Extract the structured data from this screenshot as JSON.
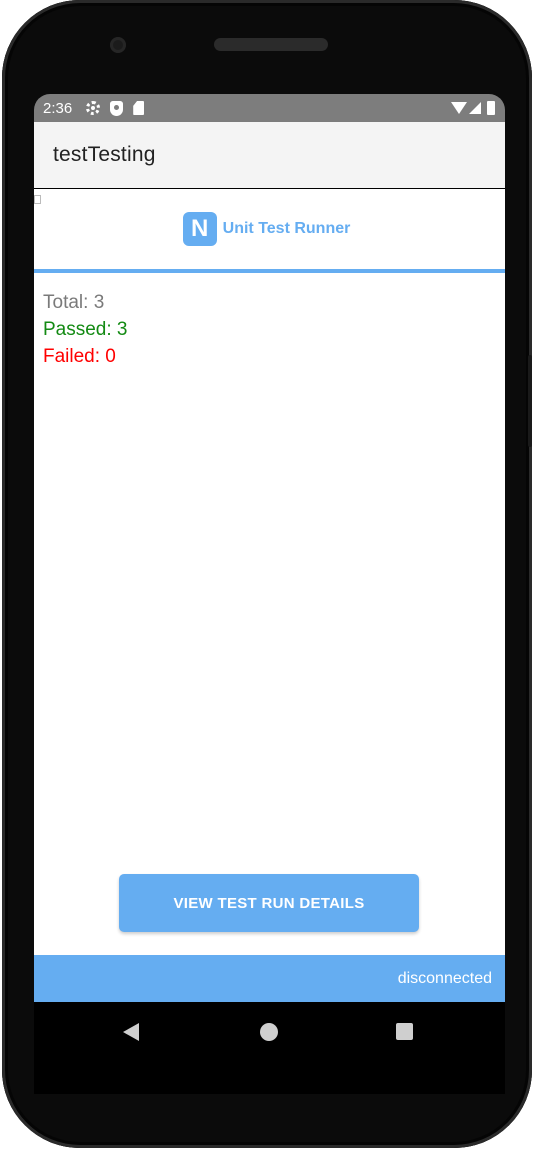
{
  "status_bar": {
    "time": "2:36",
    "left_icons": [
      "gear-icon",
      "shield-icon",
      "sd-card-icon"
    ],
    "right_icons": [
      "wifi-icon",
      "signal-icon",
      "battery-icon"
    ]
  },
  "app_bar": {
    "title": "testTesting"
  },
  "header": {
    "logo_letter": "N",
    "title": "Unit Test Runner"
  },
  "stats": {
    "total": "Total: 3",
    "passed": "Passed: 3",
    "failed": "Failed: 0"
  },
  "actions": {
    "view_details_label": "VIEW TEST RUN DETAILS"
  },
  "footer": {
    "connection_status": "disconnected"
  },
  "nav_bar": {
    "buttons": [
      "back-icon",
      "home-icon",
      "recents-icon"
    ]
  },
  "colors": {
    "accent": "#65adf1",
    "passed": "#138a13",
    "failed": "#ff0000",
    "total": "#7a7a7a"
  }
}
